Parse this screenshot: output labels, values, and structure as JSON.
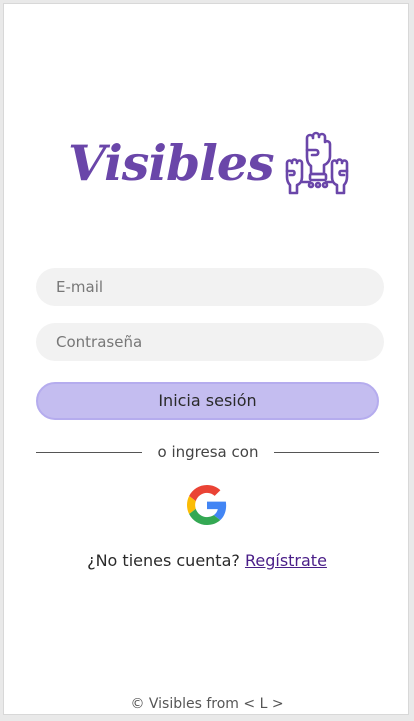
{
  "brand": {
    "name": "Visibles",
    "color": "#6a46a9",
    "icon": "raised-fists-icon"
  },
  "form": {
    "email_placeholder": "E-mail",
    "password_placeholder": "Contraseña",
    "login_label": "Inicia sesión"
  },
  "alt_login": {
    "divider_text": "o ingresa con",
    "provider_icon": "google-icon"
  },
  "signup": {
    "prompt": "¿No tienes cuenta?",
    "link_label": "Regístrate"
  },
  "footer": {
    "text": "© Visibles from < L >"
  },
  "colors": {
    "primary": "#6a46a9",
    "button_bg": "#c4bdf0",
    "input_bg": "#f2f2f2",
    "link": "#4a1e88"
  }
}
